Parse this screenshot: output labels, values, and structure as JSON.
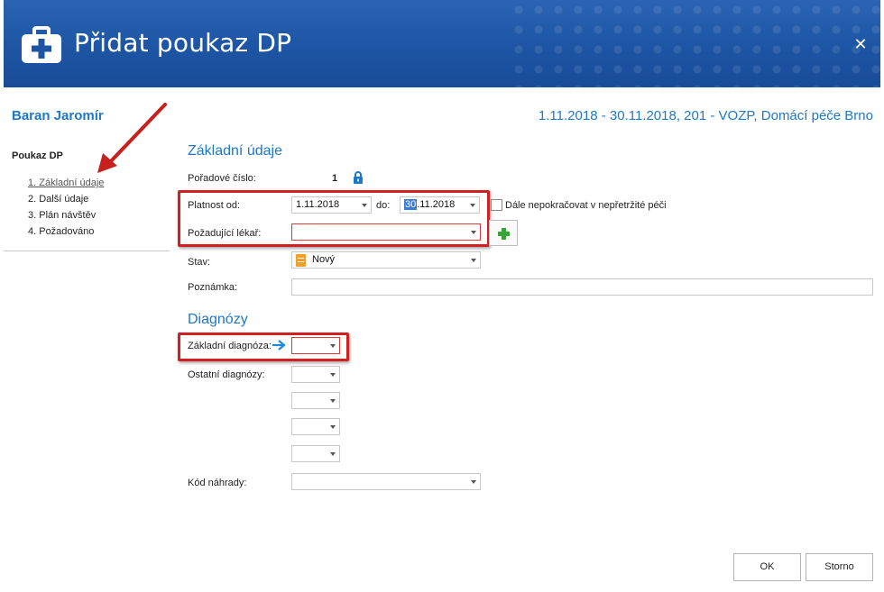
{
  "dialog": {
    "title": "Přidat poukaz DP",
    "icon": "medical-kit-icon",
    "close_icon": "close-icon"
  },
  "header": {
    "patient_name": "Baran Jaromír",
    "period": "1.11.2018 - 30.11.2018, 201 - VOZP, Domácí péče Brno"
  },
  "sidebar": {
    "title": "Poukaz DP",
    "items": [
      {
        "label": "1. Základní údaje",
        "active": true
      },
      {
        "label": "2. Další údaje",
        "active": false
      },
      {
        "label": "3. Plán návštěv",
        "active": false
      },
      {
        "label": "4. Požadováno",
        "active": false
      }
    ]
  },
  "basic": {
    "section_title": "Základní údaje",
    "order_label": "Pořadové číslo:",
    "order_value": "1",
    "valid_from_label": "Platnost od:",
    "valid_from_value": "1.11.2018",
    "to_label": "do:",
    "valid_to_day": "30",
    "valid_to_rest": ".11.2018",
    "no_continue_label": "Dále nepokračovat v nepřetržité péči",
    "doctor_label": "Požadující lékař:",
    "doctor_value": "",
    "status_label": "Stav:",
    "status_value": "Nový",
    "note_label": "Poznámka:",
    "note_value": ""
  },
  "diagnoses": {
    "section_title": "Diagnózy",
    "main_label": "Základní diagnóza:",
    "other_label": "Ostatní diagnózy:",
    "replacement_label": "Kód náhrady:"
  },
  "buttons": {
    "ok": "OK",
    "cancel": "Storno"
  },
  "colors": {
    "header_bg": "#1d55a4",
    "accent": "#1d78c8",
    "highlight_red": "#d21f1f",
    "add_green": "#3aa23a"
  }
}
